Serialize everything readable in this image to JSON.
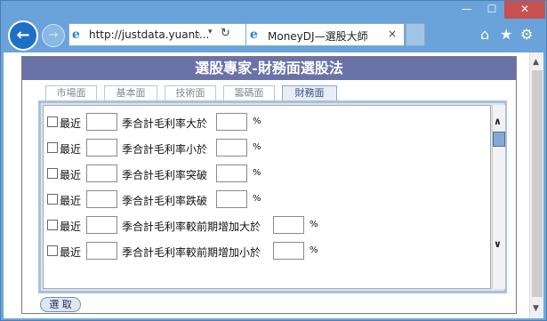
{
  "browser": {
    "address_url": "http://justdata.yuant...",
    "tab_title": "MoneyDJ—選股大師",
    "controls": {
      "minimize": "—",
      "maximize": "☐",
      "close": "✕"
    },
    "nav": {
      "back": "←",
      "forward": "→"
    },
    "address_icons": {
      "search": "⌕",
      "dropdown": "▾",
      "refresh": "↻"
    },
    "tab_close": "×",
    "ie_glyph": "e",
    "toolbar_icons": {
      "home": "⌂",
      "star": "★",
      "gear": "⚙"
    }
  },
  "page": {
    "title": "選股專家-財務面選股法",
    "tabs": [
      {
        "label": "市場面",
        "active": false
      },
      {
        "label": "基本面",
        "active": false
      },
      {
        "label": "技術面",
        "active": false
      },
      {
        "label": "籌碼面",
        "active": false
      },
      {
        "label": "財務面",
        "active": true
      }
    ],
    "criteria": [
      {
        "prefix": "最近",
        "middle": "季合計毛利率大於",
        "unit": "%"
      },
      {
        "prefix": "最近",
        "middle": "季合計毛利率小於",
        "unit": "%"
      },
      {
        "prefix": "最近",
        "middle": "季合計毛利率突破",
        "unit": "%"
      },
      {
        "prefix": "最近",
        "middle": "季合計毛利率跌破",
        "unit": "%"
      },
      {
        "prefix": "最近",
        "middle": "季合計毛利率較前期增加大於",
        "unit": "%"
      },
      {
        "prefix": "最近",
        "middle": "季合計毛利率較前期增加小於",
        "unit": "%"
      }
    ],
    "select_button": "選 取",
    "scroll_arrows": {
      "up": "∧",
      "down": "∨"
    },
    "viewport_scroll_arrows": {
      "up": "▲",
      "down": "▼"
    }
  }
}
